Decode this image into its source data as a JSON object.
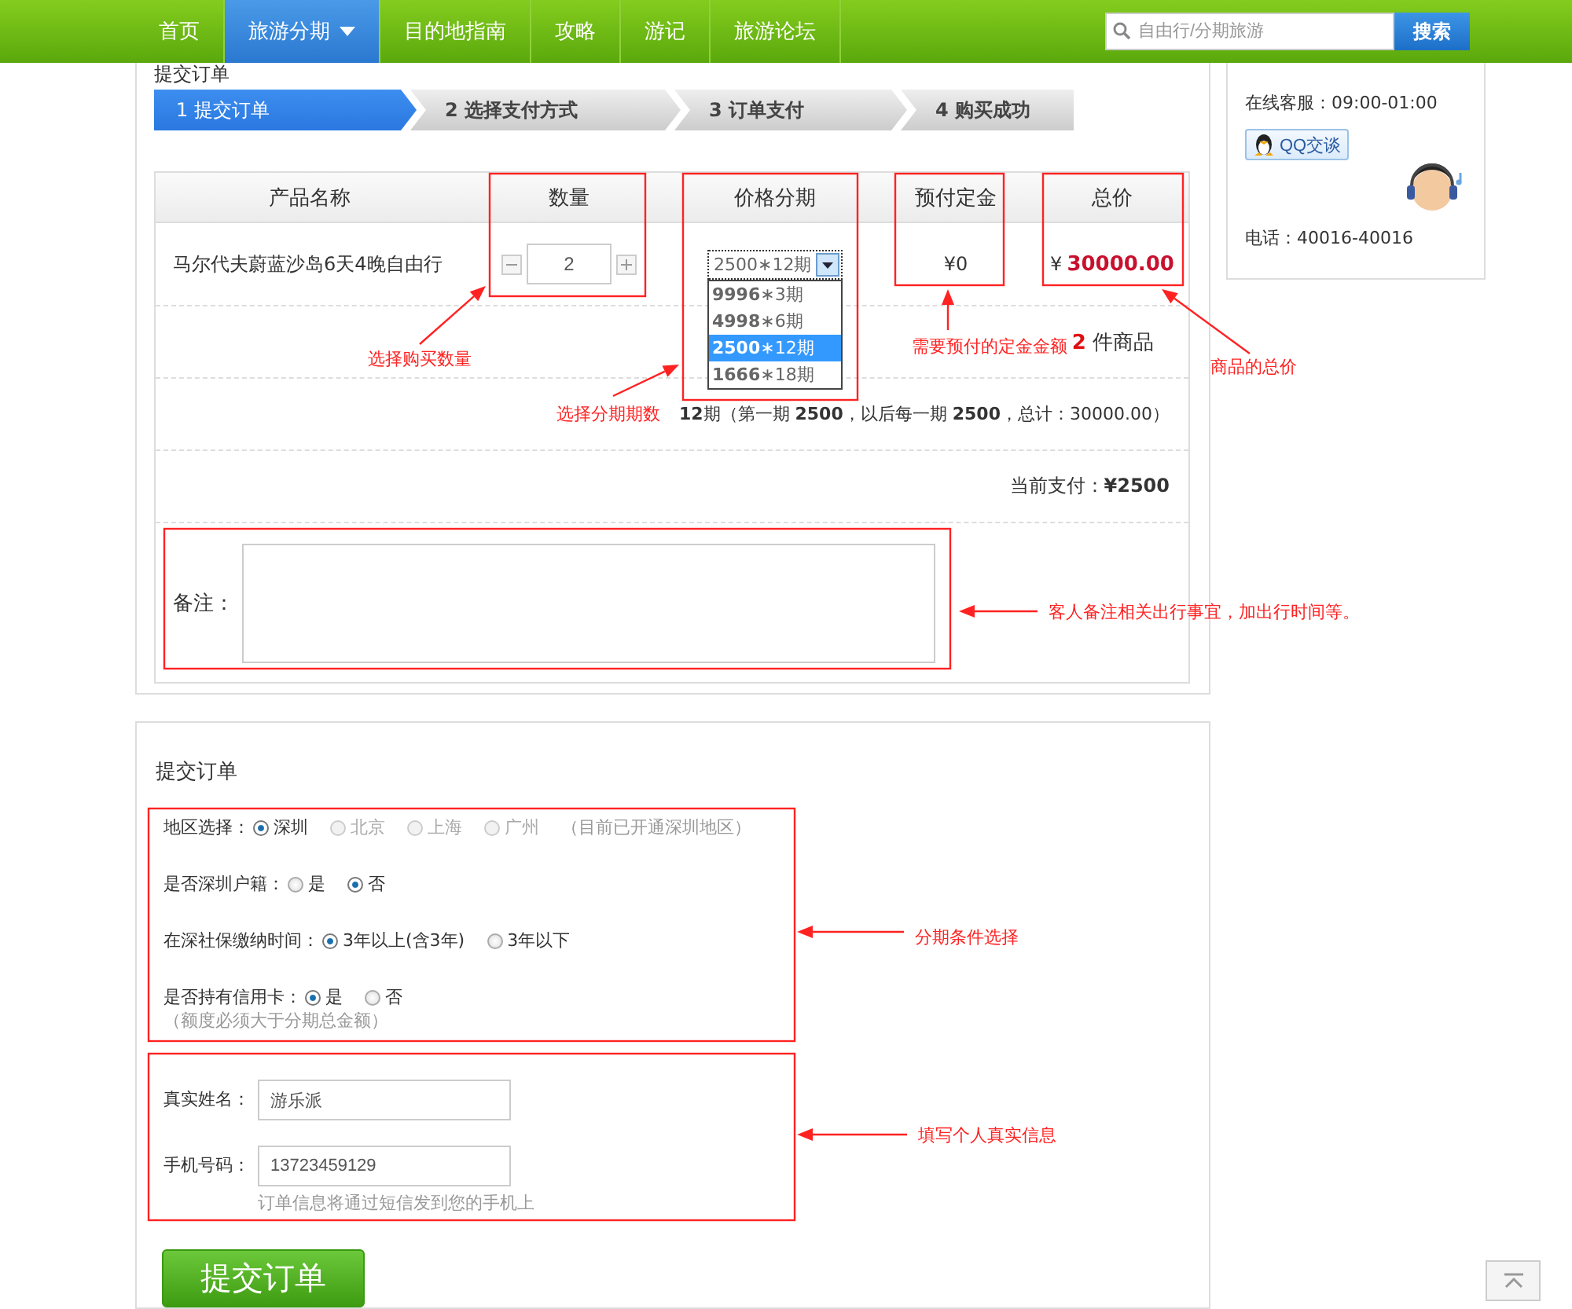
{
  "nav": {
    "items": [
      {
        "label": "首页",
        "selected": false,
        "has_menu": false
      },
      {
        "label": "旅游分期",
        "selected": true,
        "has_menu": true
      },
      {
        "label": "目的地指南",
        "selected": false,
        "has_menu": false
      },
      {
        "label": "攻略",
        "selected": false,
        "has_menu": false
      },
      {
        "label": "游记",
        "selected": false,
        "has_menu": false
      },
      {
        "label": "旅游论坛",
        "selected": false,
        "has_menu": false
      }
    ],
    "search": {
      "placeholder": "自由行/分期旅游",
      "button": "搜索"
    }
  },
  "order": {
    "title": "提交订单",
    "steps": [
      {
        "number": "1",
        "label": "提交订单",
        "selected": true
      },
      {
        "number": "2",
        "label": "选择支付方式",
        "selected": false
      },
      {
        "number": "3",
        "label": "订单支付",
        "selected": false
      },
      {
        "number": "4",
        "label": "购买成功",
        "selected": false
      }
    ],
    "columns": [
      "产品名称",
      "数量",
      "价格分期",
      "预付定金",
      "总价"
    ],
    "row": {
      "product": "马尔代夫蔚蓝沙岛6天4晚自由行",
      "quantity": "2",
      "installment": {
        "value": "2500∗12期",
        "expanded": true,
        "options": [
          {
            "amount": "9996",
            "periods": "∗3期",
            "selected": false
          },
          {
            "amount": "4998",
            "periods": "∗6期",
            "selected": false
          },
          {
            "amount": "2500",
            "periods": "∗12期",
            "selected": true
          },
          {
            "amount": "1666",
            "periods": "∗18期",
            "selected": false
          }
        ]
      },
      "deposit": "¥0",
      "total_currency": "¥",
      "total": "30000.00"
    },
    "item_count": {
      "count": "2",
      "unit": "件商品"
    },
    "summary": "**12**期（第一期 **2500**，以后每一期 **2500**，总计：30000.00）",
    "current_payment": {
      "label": "当前支付：",
      "amount": "¥2500"
    },
    "remark": {
      "label": "备注："
    }
  },
  "form": {
    "title": "提交订单",
    "radio_groups": [
      {
        "label": "地区选择：",
        "options": [
          {
            "label": "深圳",
            "selected": true,
            "disabled": false
          },
          {
            "label": "北京",
            "selected": false,
            "disabled": true
          },
          {
            "label": "上海",
            "selected": false,
            "disabled": true
          },
          {
            "label": "广州",
            "selected": false,
            "disabled": true
          }
        ],
        "note": "（目前已开通深圳地区）"
      },
      {
        "label": "是否深圳户籍：",
        "options": [
          {
            "label": "是",
            "selected": false,
            "disabled": false
          },
          {
            "label": "否",
            "selected": true,
            "disabled": false
          }
        ]
      },
      {
        "label": "在深社保缴纳时间：",
        "options": [
          {
            "label": "3年以上(含3年)",
            "selected": true,
            "disabled": false
          },
          {
            "label": "3年以下",
            "selected": false,
            "disabled": false
          }
        ]
      },
      {
        "label": "是否持有信用卡：",
        "options": [
          {
            "label": "是",
            "selected": true,
            "disabled": false
          },
          {
            "label": "否",
            "selected": false,
            "disabled": false
          }
        ],
        "hint": "（额度必须大于分期总金额）"
      }
    ],
    "fields": [
      {
        "label": "真实姓名：",
        "value": "游乐派"
      },
      {
        "label": "手机号码：",
        "value": "13723459129",
        "hint": "订单信息将通过短信发到您的手机上"
      }
    ],
    "submit": "提交订单"
  },
  "sidebar": {
    "hours": "在线客服：09:00-01:00",
    "qq_button": "QQ交谈",
    "phone": "电话：40016-40016"
  },
  "annotations": [
    {
      "text": "选择购买数量"
    },
    {
      "text": "选择分期期数"
    },
    {
      "text": "需要预付的定金金额"
    },
    {
      "text": "商品的总价"
    },
    {
      "text": "客人备注相关出行事宜，加出行时间等。"
    },
    {
      "text": "分期条件选择"
    },
    {
      "text": "填写个人真实信息"
    }
  ]
}
